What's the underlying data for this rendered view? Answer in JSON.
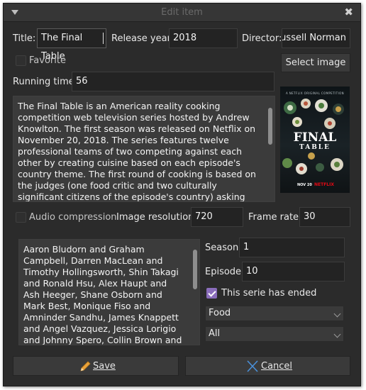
{
  "window": {
    "title": "Edit item"
  },
  "form": {
    "title_label": "Title:",
    "title_value": "The Final Table",
    "year_label": "Release year:",
    "year_value": "2018",
    "director_label": "Director:",
    "director_value": "Russell Norman",
    "favorite_label": "Favorite",
    "favorite_checked": false,
    "select_image_label": "Select image",
    "running_time_label": "Running time",
    "running_time_value": "56",
    "description": "The Final Table is an American reality cooking competition web television series hosted by Andrew Knowlton. The first season was released on Netflix on November 20, 2018. The series features twelve professional teams of two competing against each other by creating cuisine based on each episode's country theme. The first round of cooking is based on the judges (one food critic and two culturally significant citizens of the episode's country) asking the contestants to cook a nationally significant dish. The bottom three dishes",
    "audio_label": "Audio compression",
    "audio_checked": false,
    "resolution_label": "Image resolution:",
    "resolution_value": "720",
    "framerate_label": "Frame rate:",
    "framerate_value": "30",
    "cast": "Aaron Bludorn and Graham Campbell, Darren MacLean and Timothy Hollingsworth, Shin Takagi and Ronald Hsu, Alex Haupt and Ash Heeger, Shane Osborn and Mark Best, Monique Fiso and Amninder Sandhu, James Knappett and Angel Vazquez, Jessica Lorigio and Johnny Spero, Collin Brown and Colibri Jimenez, Esdras Ochoa and Rafa Gil,",
    "season_label": "Season",
    "season_value": "1",
    "episode_label": "Episode",
    "episode_value": "10",
    "ended_label": "This serie has ended",
    "ended_checked": true,
    "genre_selected": "Food",
    "filter_selected": "All"
  },
  "poster": {
    "tagline": "A NETFLIX ORIGINAL COMPETITION",
    "title_line1": "FINAL",
    "title_line2": "TABLE",
    "date_text": "NOV 20",
    "brand_text": "NETFLIX",
    "brand_color": "#e50914"
  },
  "buttons": {
    "save_label": "Save",
    "cancel_label": "Cancel"
  },
  "colors": {
    "window_bg": "#2b2b2b",
    "accent": "#8a6dbb"
  }
}
